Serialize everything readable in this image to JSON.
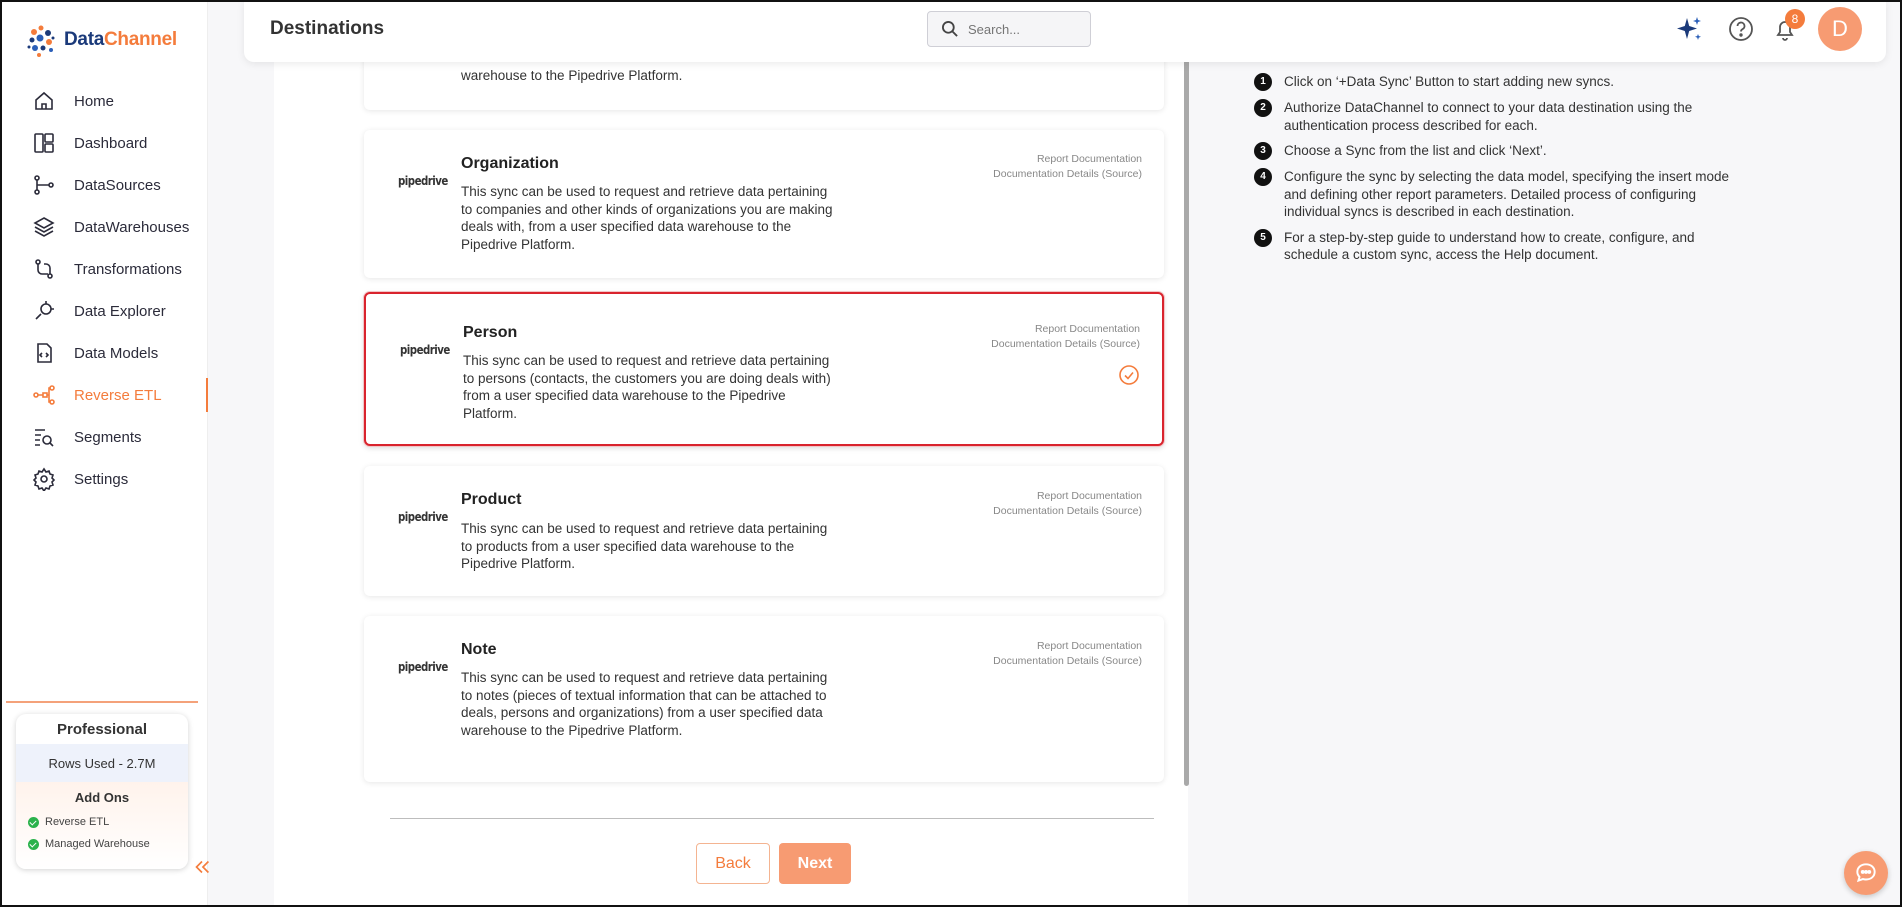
{
  "brand": {
    "name_part1": "Data",
    "name_part2": "Channel"
  },
  "sidebar": {
    "items": [
      {
        "label": "Home",
        "icon": "home-icon"
      },
      {
        "label": "Dashboard",
        "icon": "dashboard-icon"
      },
      {
        "label": "DataSources",
        "icon": "datasources-icon"
      },
      {
        "label": "DataWarehouses",
        "icon": "datawarehouses-icon"
      },
      {
        "label": "Transformations",
        "icon": "transformations-icon"
      },
      {
        "label": "Data Explorer",
        "icon": "data-explorer-icon"
      },
      {
        "label": "Data Models",
        "icon": "data-models-icon"
      },
      {
        "label": "Reverse ETL",
        "icon": "reverse-etl-icon",
        "active": true
      },
      {
        "label": "Segments",
        "icon": "segments-icon"
      },
      {
        "label": "Settings",
        "icon": "settings-icon"
      }
    ],
    "plan": {
      "name": "Professional",
      "rows_used": "Rows Used - 2.7M",
      "addons_title": "Add Ons",
      "addons": [
        "Reverse ETL",
        "Managed Warehouse"
      ]
    },
    "collapse_icon": "double-chevron-left-icon"
  },
  "header": {
    "title": "Destinations",
    "search_placeholder": "Search...",
    "notification_count": "8",
    "avatar_initial": "D"
  },
  "syncs": [
    {
      "name": "",
      "logo": "pipedrive",
      "description": "warehouse to the Pipedrive Platform.",
      "links": []
    },
    {
      "name": "Organization",
      "logo": "pipedrive",
      "description": "This sync can be used to request and retrieve data pertaining to companies and other kinds of organizations you are making deals with, from a user specified data warehouse to the Pipedrive Platform.",
      "links": [
        "Report Documentation",
        "Documentation Details (Source)"
      ]
    },
    {
      "name": "Person",
      "logo": "pipedrive",
      "description": "This sync can be used to request and retrieve data pertaining to persons (contacts, the customers you are doing deals with) from a user specified data warehouse to the Pipedrive Platform.",
      "links": [
        "Report Documentation",
        "Documentation Details (Source)"
      ],
      "selected": true
    },
    {
      "name": "Product",
      "logo": "pipedrive",
      "description": "This sync can be used to request and retrieve data pertaining to products from a user specified data warehouse to the Pipedrive Platform.",
      "links": [
        "Report Documentation",
        "Documentation Details (Source)"
      ]
    },
    {
      "name": "Note",
      "logo": "pipedrive",
      "description": "This sync can be used to request and retrieve data pertaining to notes (pieces of textual information that can be attached to deals, persons and organizations) from a user specified data warehouse to the Pipedrive Platform.",
      "links": [
        "Report Documentation",
        "Documentation Details (Source)"
      ]
    }
  ],
  "buttons": {
    "back": "Back",
    "next": "Next"
  },
  "instructions": [
    {
      "num": "1",
      "text": "Click on ‘+Data Sync’ Button to start adding new syncs."
    },
    {
      "num": "2",
      "text": "Authorize DataChannel to connect to your data destination using the authentication process described for each."
    },
    {
      "num": "3",
      "text": "Choose a Sync from the list and click ‘Next’."
    },
    {
      "num": "4",
      "text": "Configure the sync by selecting the data model, specifying the insert mode and defining other report parameters. Detailed process of configuring individual syncs is described in each destination."
    },
    {
      "num": "5",
      "text": "For a step-by-step guide to understand how to create, configure, and schedule a custom sync, access the Help document."
    }
  ],
  "colors": {
    "accent": "#f47c3c",
    "brand_blue": "#1b3a7a",
    "selected_border": "#d9232d",
    "success": "#2bb24c"
  }
}
